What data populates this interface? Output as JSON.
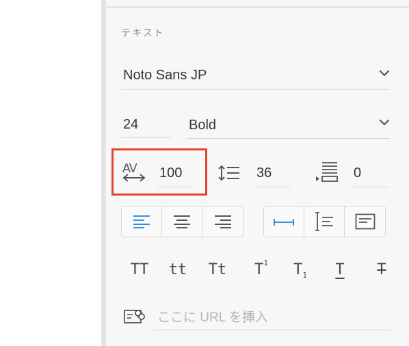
{
  "section": {
    "title": "テキスト"
  },
  "font_family": {
    "value": "Noto Sans JP"
  },
  "font_size": {
    "value": "24"
  },
  "font_weight": {
    "value": "Bold"
  },
  "letter_spacing": {
    "icon_label": "AV",
    "value": "100"
  },
  "line_height": {
    "value": "36"
  },
  "paragraph_spacing": {
    "value": "0"
  },
  "align_buttons": {
    "selected": "left"
  },
  "vertical_align_buttons": {
    "selected": "top"
  },
  "text_case_buttons": [
    {
      "label": "TT"
    },
    {
      "label": "tt"
    },
    {
      "label": "Tt"
    },
    {
      "label": "T",
      "suffix": "1"
    },
    {
      "label": "T",
      "suffix": "1"
    },
    {
      "label": "T"
    },
    {
      "label": "T"
    }
  ],
  "url": {
    "placeholder": "ここに URL を挿入"
  },
  "colors": {
    "accent": "#3b8fd6",
    "highlight": "#e5432d"
  }
}
